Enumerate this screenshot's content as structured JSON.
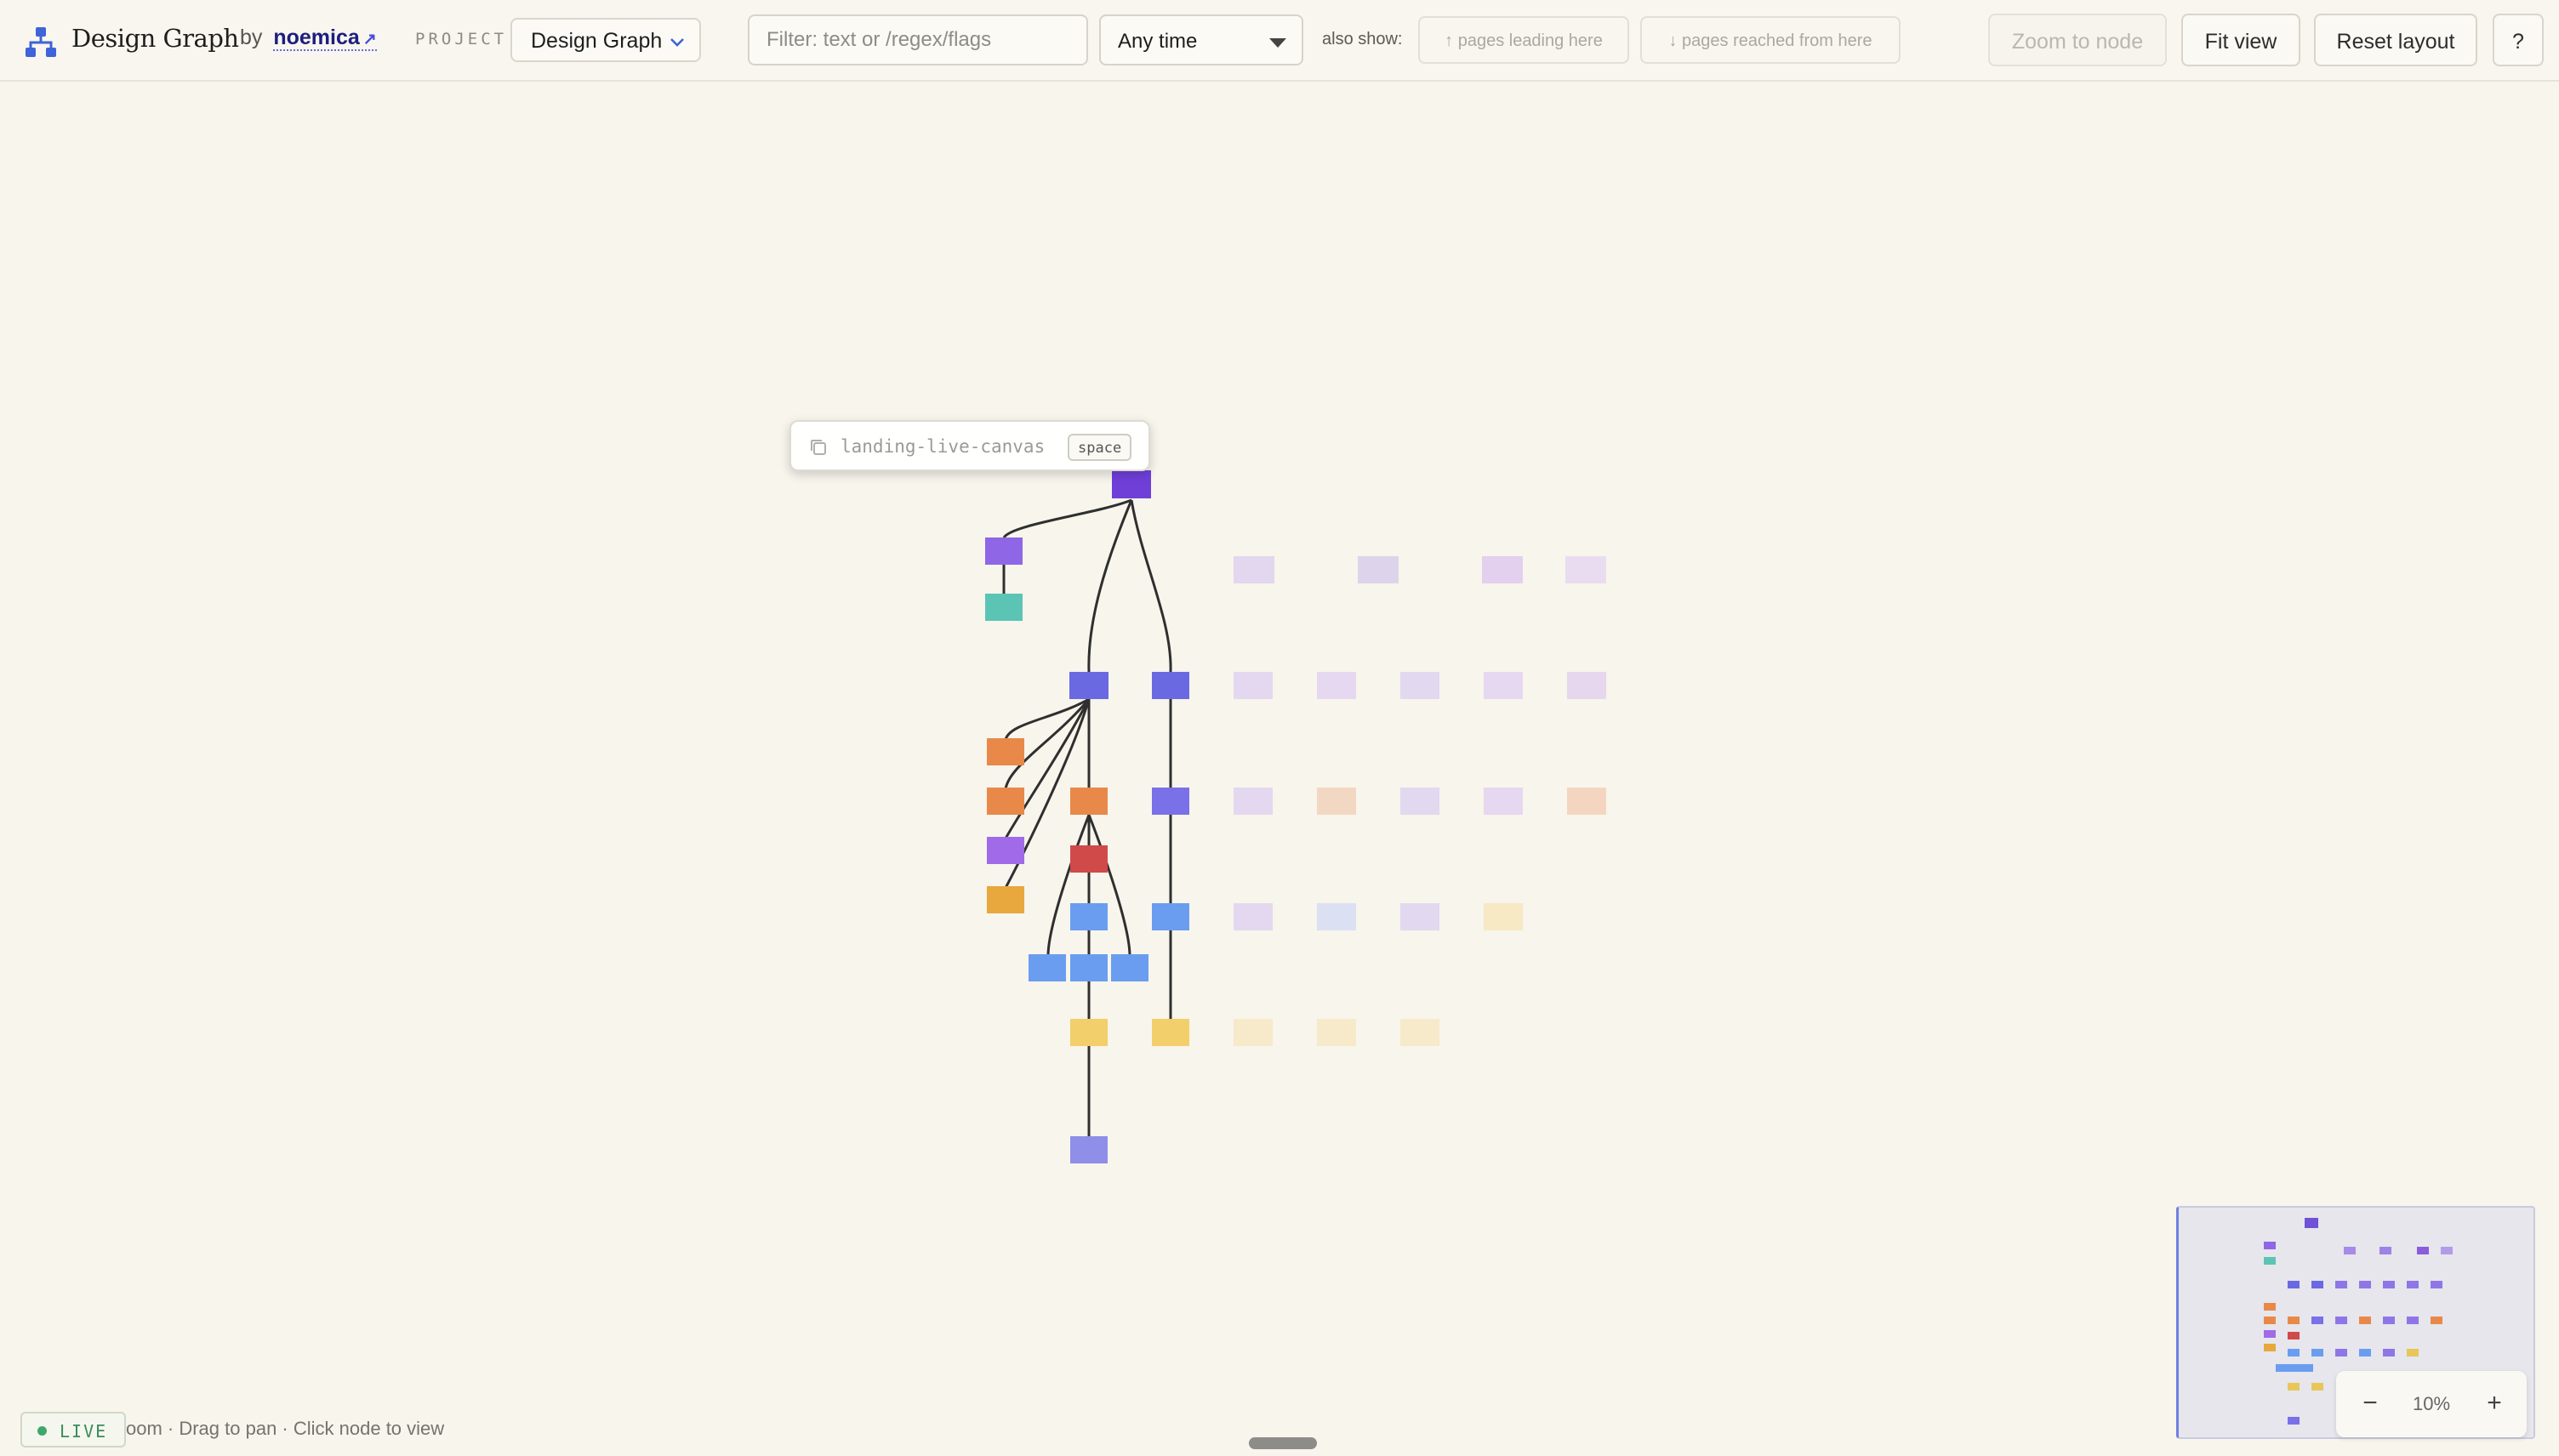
{
  "header": {
    "brand": "Design Graph",
    "by_label": "by",
    "author": "noemica",
    "author_arrow": "↗",
    "project_label": "PROJECT",
    "project_value": "Design Graph",
    "filter_placeholder": "Filter: text or /regex/flags",
    "time_filter": "Any time",
    "also_show_label": "also show:",
    "pages_leading_here": "↑ pages leading here",
    "pages_reached_from_here": "↓ pages reached from here",
    "zoom_to_node": "Zoom to node",
    "fit_view": "Fit view",
    "reset_layout": "Reset layout",
    "help": "?"
  },
  "tooltip": {
    "node_name": "landing-live-canvas",
    "key_hint": "space"
  },
  "hint_text": "oom · Drag to pan · Click node to view",
  "live_badge": "LIVE",
  "zoom": {
    "minus": "−",
    "level": "10%",
    "plus": "+"
  },
  "colors": {
    "background": "#f7f5ec",
    "root": "#6f3fd8",
    "violet": "#8f66e6",
    "indigo": "#6b69e2",
    "teal": "#5cc4b4",
    "orange": "#e8894a",
    "red": "#d04a4a",
    "blue": "#6a9df0",
    "yellow": "#f2cf6a",
    "amber": "#e8a83e",
    "periwinkle": "#8f8ee8",
    "live_green": "#3fa76b"
  },
  "icons": {
    "logo": "hierarchy-logo-icon",
    "author_link": "external-link-icon",
    "project_dropdown": "chevron-down-icon",
    "time_dropdown": "caret-down-icon",
    "tooltip_copy": "copy-icon"
  }
}
